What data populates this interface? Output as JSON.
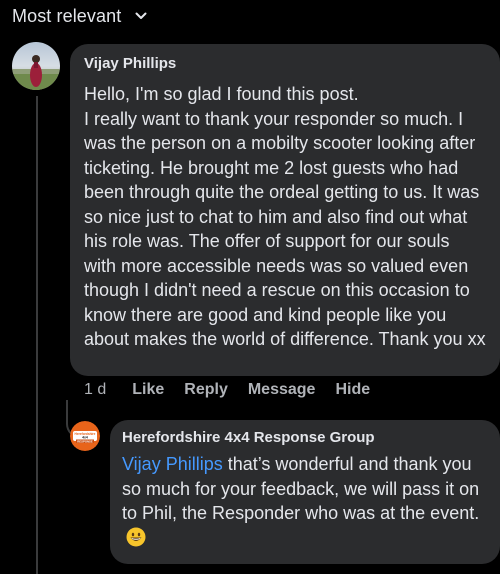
{
  "sort": {
    "label": "Most relevant",
    "icon": "chevron-down-icon"
  },
  "comment": {
    "author": "Vijay Phillips",
    "text": "Hello, I'm so glad I found this post.\nI really want to thank your responder so much. I was the person on a mobilty scooter looking after ticketing. He brought me 2 lost guests who had been through quite the ordeal getting to us. It was so nice just to chat to him and also find out what his role was. The offer of support for our souls with more accessible  needs was so valued even though I didn't need a rescue on this occasion to know there are good and kind people like you about makes the world of difference. Thank you xx",
    "time": "1 d",
    "actions": {
      "like": "Like",
      "reply": "Reply",
      "message": "Message",
      "hide": "Hide"
    }
  },
  "reply": {
    "author": "Herefordshire 4x4 Response Group",
    "mention": "Vijay Phillips",
    "text": " that’s wonderful and thank you so much for your feedback, we will pass it on to Phil, the Responder who was at the event. ",
    "emoji": "grinning-face-emoji",
    "logo_text": {
      "line1": "Herefordshire",
      "line2": "4x4",
      "line3": "RESPONSE"
    }
  },
  "colors": {
    "background": "#000000",
    "bubble": "#2b2c2e",
    "text": "#e4e6eb",
    "muted": "#b0b3b8",
    "mention": "#4599ff",
    "logo_orange": "#e8641a"
  }
}
